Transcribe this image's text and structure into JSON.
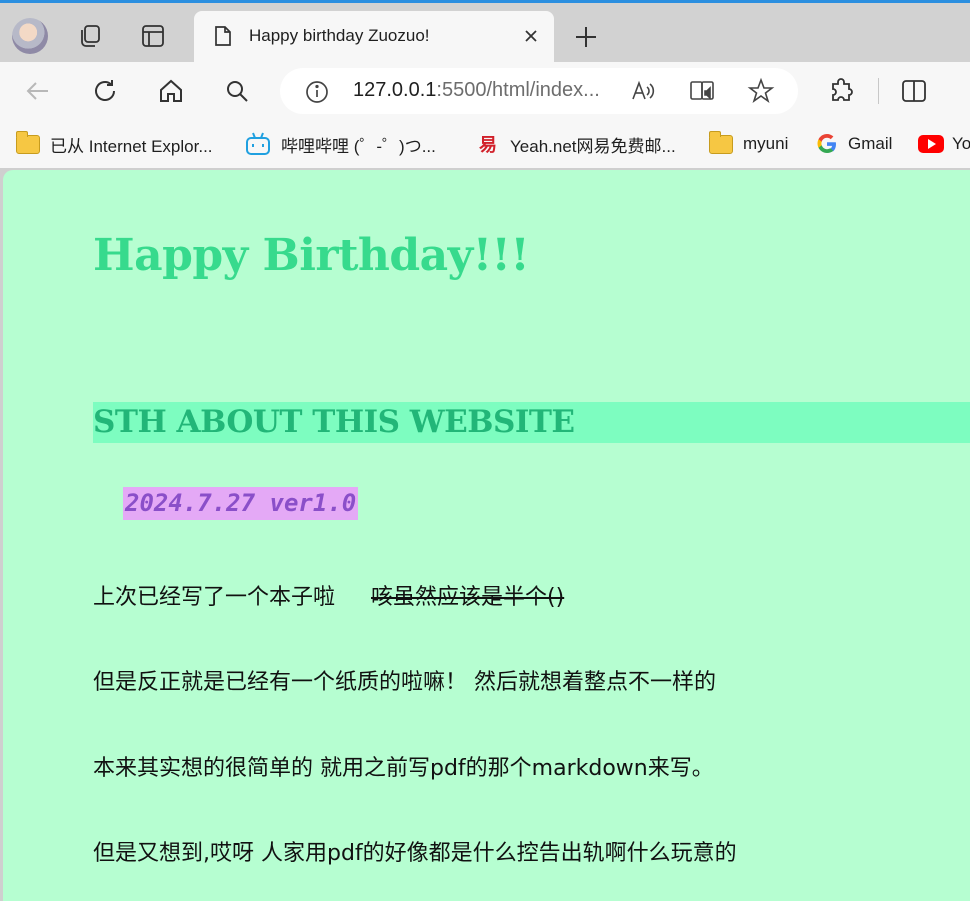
{
  "browser": {
    "tab": {
      "title": "Happy birthday Zuozuo!"
    },
    "address": {
      "host": "127.0.0.1",
      "rest": ":5500/html/index..."
    },
    "bookmarks": [
      {
        "label": "已从 Internet Explor...",
        "icon": "folder-icon"
      },
      {
        "label": "哔哩哔哩 (゜-゜)つ...",
        "icon": "bilibili-icon"
      },
      {
        "label": "Yeah.net网易免费邮...",
        "icon": "netease-mail-icon"
      },
      {
        "label": "myuni",
        "icon": "folder-icon"
      },
      {
        "label": "Gmail",
        "icon": "google-icon"
      },
      {
        "label": "Yo",
        "icon": "youtube-icon"
      }
    ],
    "colors": {
      "tabstrip": "#d2d2d2",
      "toolbar": "#f7f7f7",
      "accent": "#2b8fe0"
    }
  },
  "page": {
    "title": "Happy Birthday!!!",
    "section_heading": "STH ABOUT THIS WEBSITE",
    "version": "2024.7.27 ver1.0",
    "paragraphs": [
      {
        "text": "上次已经写了一个本子啦",
        "strike": "咳虽然应该是半个()"
      },
      {
        "text": "但是反正就是已经有一个纸质的啦嘛！ 然后就想着整点不一样的"
      },
      {
        "text": "本来其实想的很简单的 就用之前写pdf的那个markdown来写。"
      },
      {
        "text": "但是又想到,哎呀 人家用pdf的好像都是什么控告出轨啊什么玩意的"
      }
    ],
    "colors": {
      "background": "#b6fed1",
      "title": "#37da8d",
      "heading_bg": "#7dfdc0",
      "heading_text": "#22b678",
      "version_bg": "#e4a9f6",
      "version_text": "#8a4fc9"
    }
  }
}
